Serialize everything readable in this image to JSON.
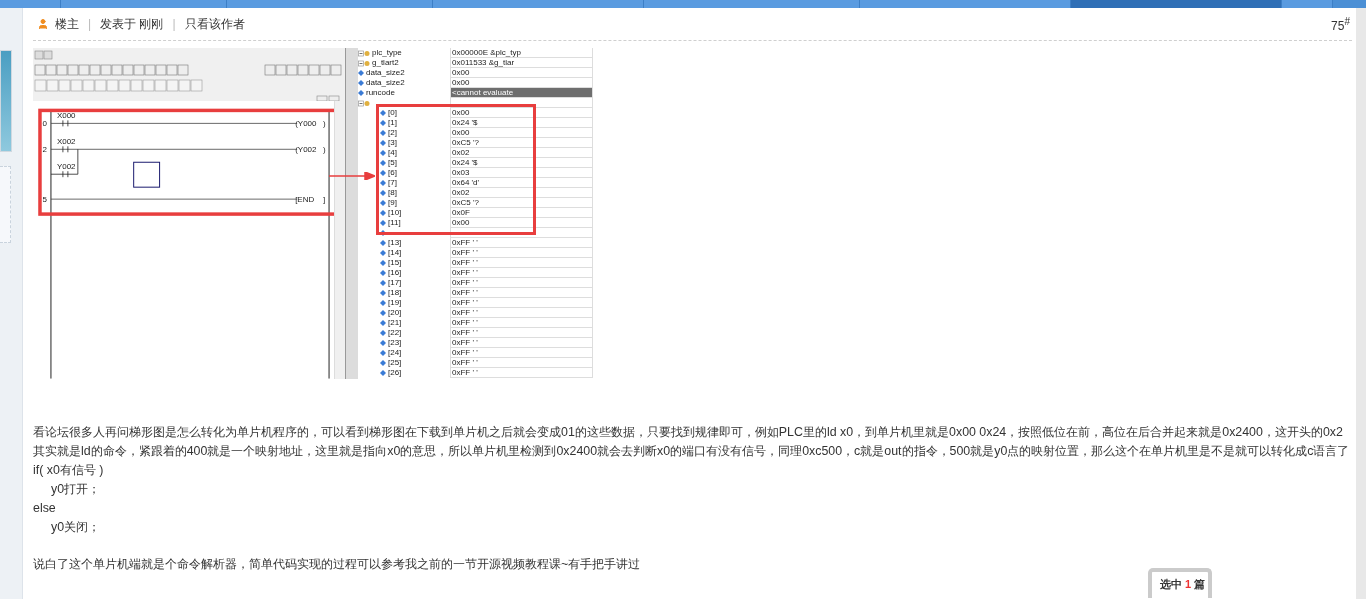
{
  "post": {
    "role": "楼主",
    "separator_1": "|",
    "posted": "发表于 刚刚",
    "separator_2": "|",
    "only_author": "只看该作者",
    "floor": "75$^{#}$"
  },
  "screenshot": {
    "ladder": {
      "rungs": [
        {
          "step": "0",
          "contact": "X000",
          "coil": "(Y000",
          "coil_end": ")"
        },
        {
          "step": "2",
          "contact": "X002",
          "branch_contact": "Y002",
          "coil": "(Y002",
          "coil_end": ")"
        },
        {
          "step": "5",
          "coil": "[END",
          "coil_end": "]"
        }
      ]
    },
    "watch": {
      "rows": [
        {
          "kind": "struct",
          "name": "plc_type",
          "value": "0x00000E &plc_typ"
        },
        {
          "kind": "struct",
          "name": "g_tlart2",
          "value": "0x011533 &g_tlar"
        },
        {
          "kind": "field",
          "name": "data_size2",
          "value": "0x00"
        },
        {
          "kind": "field",
          "name": "data_size2",
          "value": "0x00"
        },
        {
          "kind": "error",
          "name": "runcode",
          "value": "<cannot evaluate"
        },
        {
          "kind": "struct_open",
          "name": "",
          "value": ""
        },
        {
          "kind": "item",
          "name": "[0]",
          "value": "0x00"
        },
        {
          "kind": "item",
          "name": "[1]",
          "value": "0x24 '$"
        },
        {
          "kind": "item",
          "name": "[2]",
          "value": "0x00"
        },
        {
          "kind": "item",
          "name": "[3]",
          "value": "0xC5 '?"
        },
        {
          "kind": "item",
          "name": "[4]",
          "value": "0x02"
        },
        {
          "kind": "item",
          "name": "[5]",
          "value": "0x24 '$"
        },
        {
          "kind": "item",
          "name": "[6]",
          "value": "0x03"
        },
        {
          "kind": "item",
          "name": "[7]",
          "value": "0x64 'd'"
        },
        {
          "kind": "item",
          "name": "[8]",
          "value": "0x02"
        },
        {
          "kind": "item",
          "name": "[9]",
          "value": "0xC5 '?"
        },
        {
          "kind": "item",
          "name": "[10]",
          "value": "0x0F"
        },
        {
          "kind": "item",
          "name": "[11]",
          "value": "0x00"
        },
        {
          "kind": "item",
          "name": "",
          "value": ""
        },
        {
          "kind": "item",
          "name": "[13]",
          "value": "0xFF ' '"
        },
        {
          "kind": "item",
          "name": "[14]",
          "value": "0xFF ' '"
        },
        {
          "kind": "item",
          "name": "[15]",
          "value": "0xFF ' '"
        },
        {
          "kind": "item",
          "name": "[16]",
          "value": "0xFF ' '"
        },
        {
          "kind": "item",
          "name": "[17]",
          "value": "0xFF ' '"
        },
        {
          "kind": "item",
          "name": "[18]",
          "value": "0xFF ' '"
        },
        {
          "kind": "item",
          "name": "[19]",
          "value": "0xFF ' '"
        },
        {
          "kind": "item",
          "name": "[20]",
          "value": "0xFF ' '"
        },
        {
          "kind": "item",
          "name": "[21]",
          "value": "0xFF ' '"
        },
        {
          "kind": "item",
          "name": "[22]",
          "value": "0xFF ' '"
        },
        {
          "kind": "item",
          "name": "[23]",
          "value": "0xFF ' '"
        },
        {
          "kind": "item",
          "name": "[24]",
          "value": "0xFF ' '"
        },
        {
          "kind": "item",
          "name": "[25]",
          "value": "0xFF ' '"
        },
        {
          "kind": "item",
          "name": "[26]",
          "value": "0xFF ' '"
        }
      ]
    }
  },
  "body": [
    {
      "kind": "paragraph",
      "text": "看论坛很多人再问梯形图是怎么转化为单片机程序的，可以看到梯形图在下载到单片机之后就会变成01的这些数据，只要找到规律即可，例如PLC里的ld x0，到单片机里就是0x00 0x24，按照低位在前，高位在后合并起来就是0x2400，这开头的0x2其实就是ld的命令，紧跟着的400就是一个映射地址，这里就是指向x0的意思，所以单片机里检测到0x2400就会去判断x0的端口有没有信号，同理0xc500，c就是out的指令，500就是y0点的映射位置，那么这个在单片机里是不是就可以转化成c语言了"
    },
    {
      "kind": "code",
      "text": "if( x0有信号 )"
    },
    {
      "kind": "code_indented",
      "text": "y0打开；"
    },
    {
      "kind": "code",
      "text": "else"
    },
    {
      "kind": "code_indented",
      "text": "y0关闭；"
    },
    {
      "kind": "paragraph_spaced",
      "text": "说白了这个单片机端就是个命令解析器，简单代码实现的过程可以参考我之前的一节开源视频教程课~有手把手讲过"
    }
  ],
  "selection_popup": {
    "label": "选中",
    "count": "1",
    "unit": "篇"
  }
}
